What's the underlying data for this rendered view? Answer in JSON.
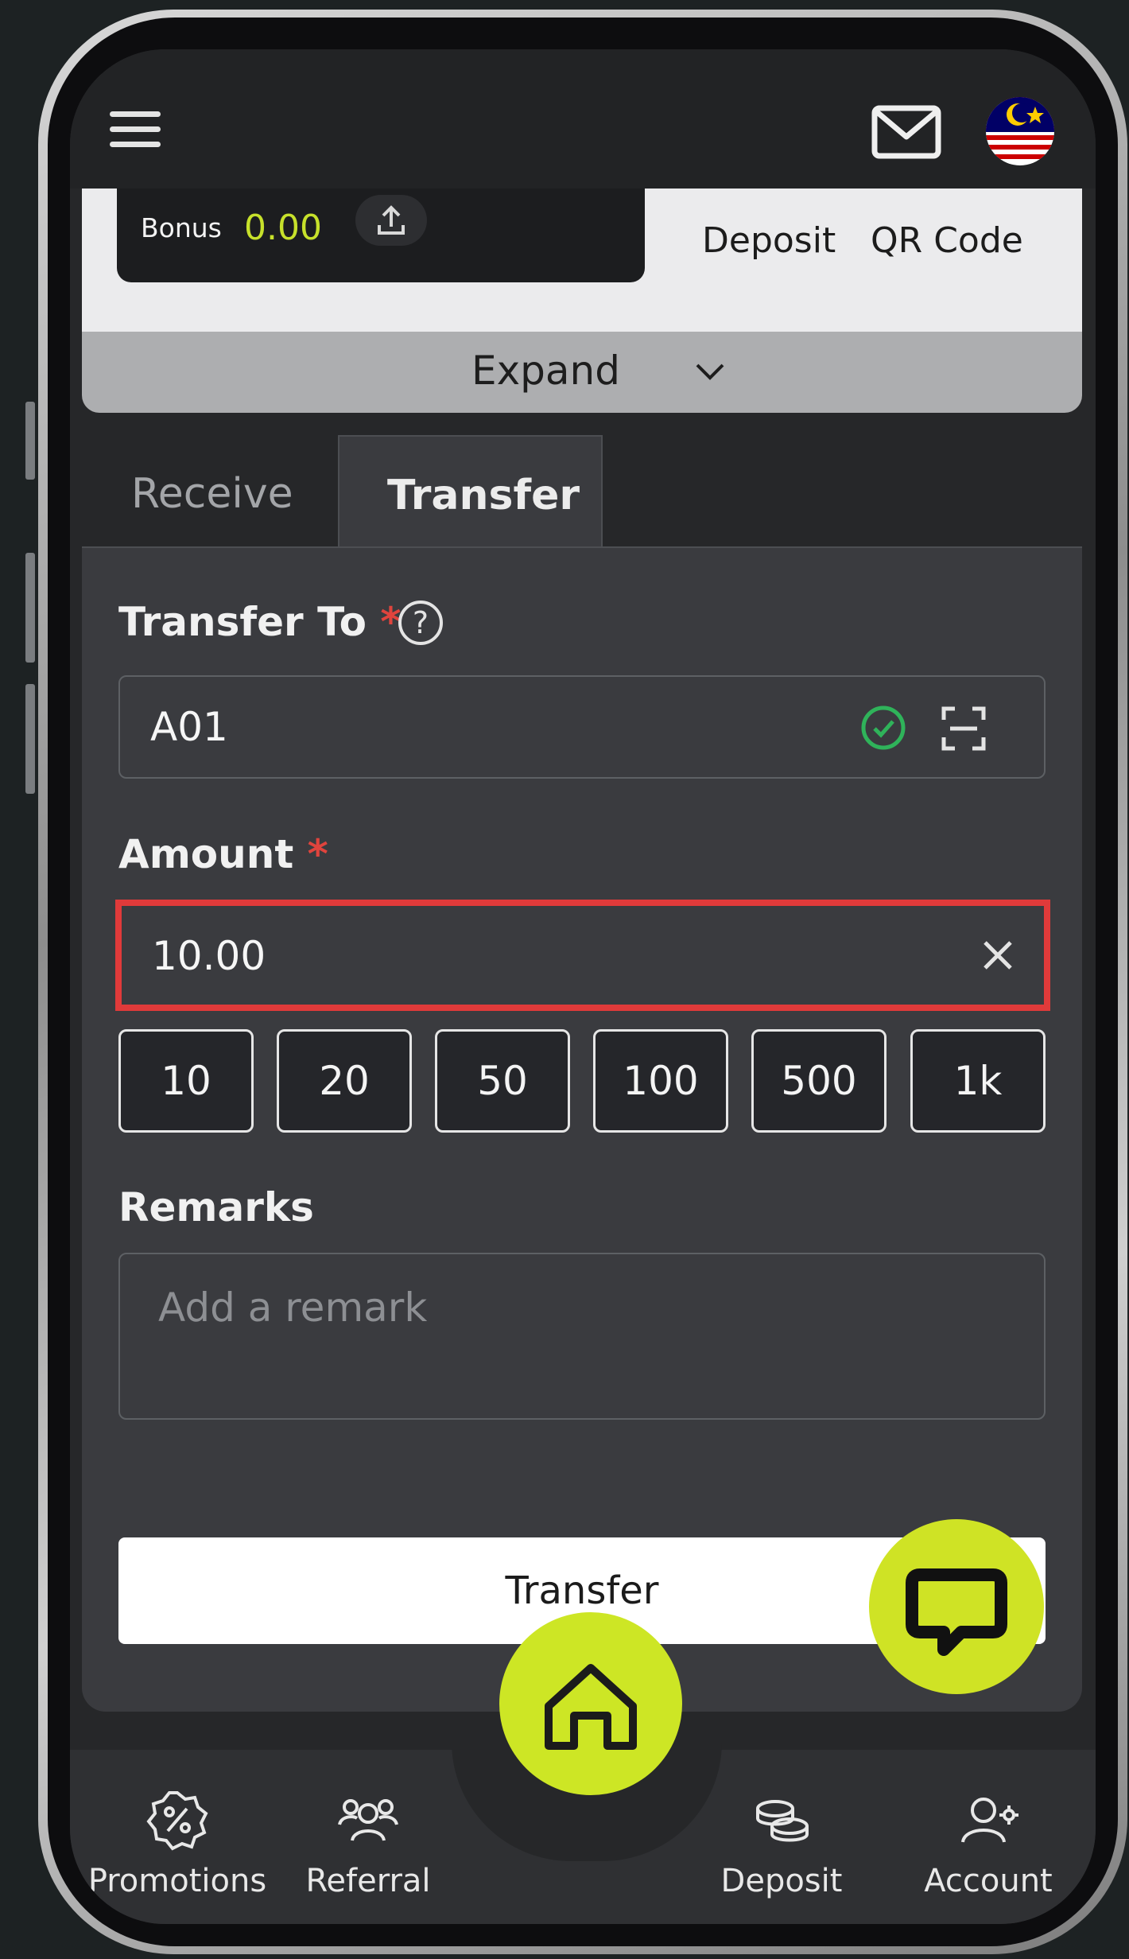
{
  "header": {
    "menu_icon": "hamburger-menu-icon",
    "mail_icon": "mail-icon",
    "flag_icon": "malaysia-flag-icon"
  },
  "wallet": {
    "bonus_label": "Bonus",
    "bonus_value": "0.00",
    "deposit_link": "Deposit",
    "qr_code_link": "QR Code",
    "expand_label": "Expand"
  },
  "tabs": {
    "receive": "Receive",
    "transfer": "Transfer"
  },
  "form": {
    "transfer_to_label": "Transfer To",
    "required_mark": "*",
    "help_glyph": "?",
    "transfer_to_value": "A01",
    "amount_label": "Amount",
    "amount_value": "10.00",
    "quick_amounts": [
      "10",
      "20",
      "50",
      "100",
      "500",
      "1k"
    ],
    "remarks_label": "Remarks",
    "remarks_placeholder": "Add a remark",
    "submit_label": "Transfer"
  },
  "bottom_nav": {
    "promotions": "Promotions",
    "referral": "Referral",
    "deposit": "Deposit",
    "account": "Account"
  },
  "colors": {
    "accent": "#cde625",
    "error_border": "#e03a3a",
    "valid_check": "#2fb35a",
    "required": "#e0443d"
  }
}
